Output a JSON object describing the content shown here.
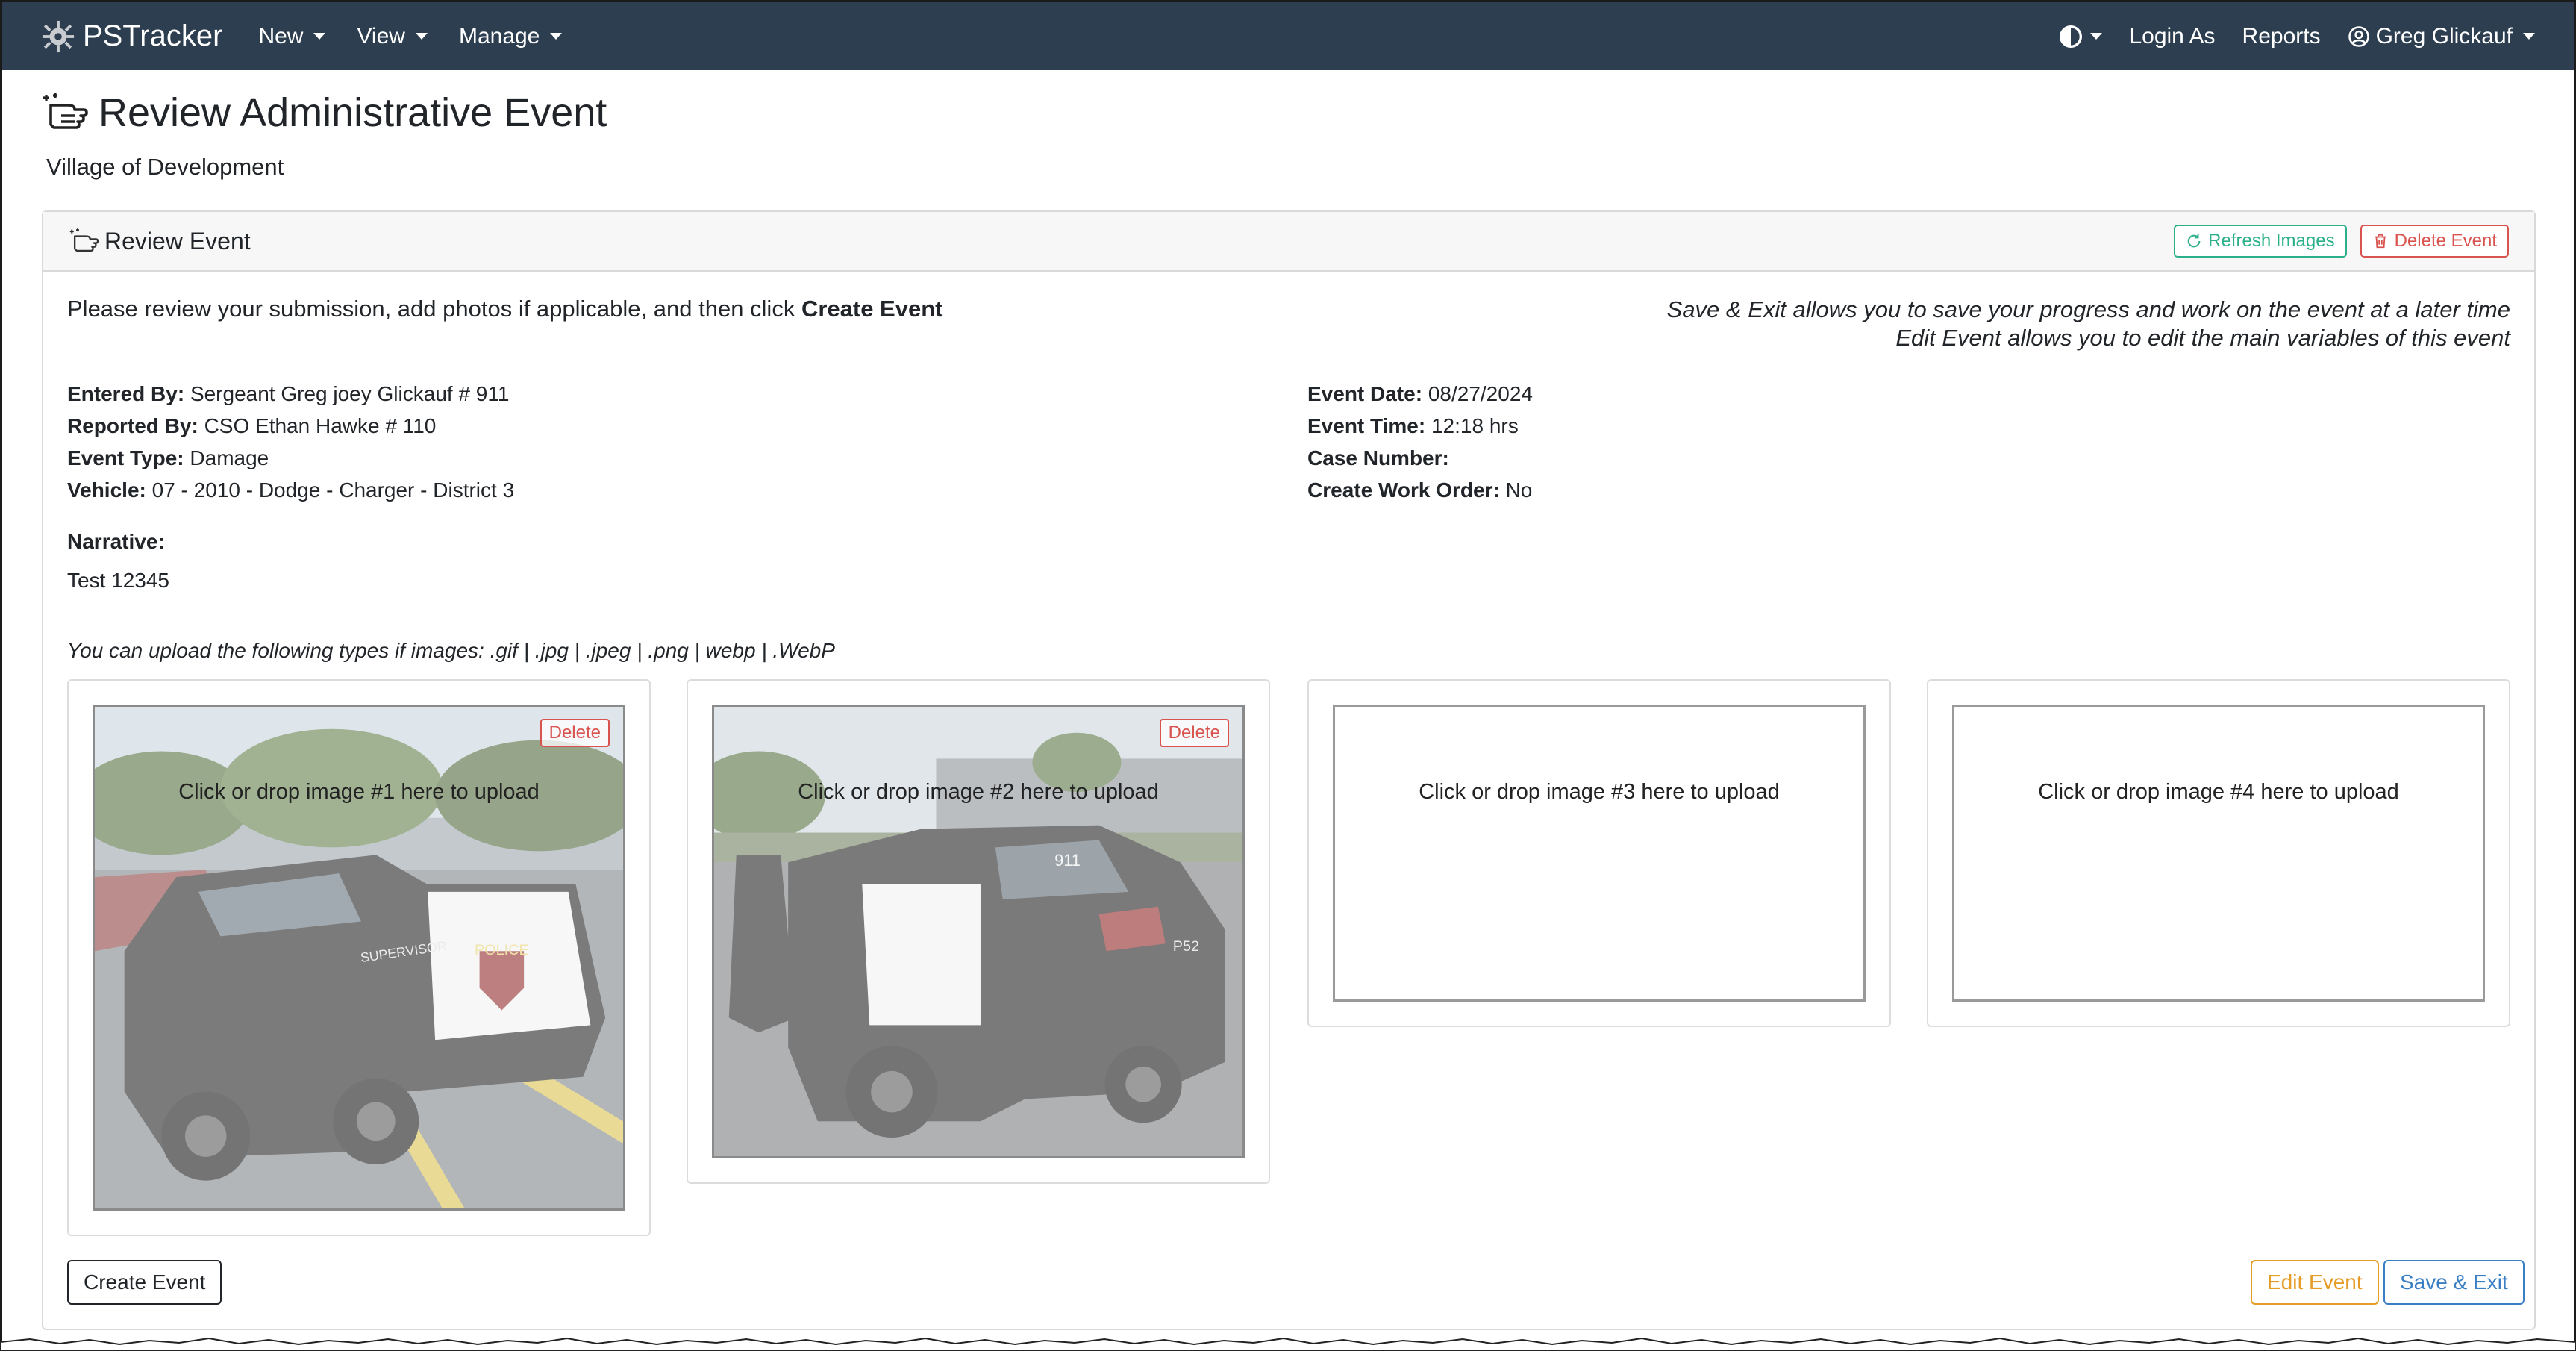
{
  "navbar": {
    "brand": "PSTracker",
    "menus": [
      "New",
      "View",
      "Manage"
    ],
    "login_as": "Login As",
    "reports": "Reports",
    "user": "Greg Glickauf"
  },
  "page": {
    "title": "Review Administrative Event",
    "subtitle": "Village of Development"
  },
  "card": {
    "header": "Review Event",
    "refresh_label": "Refresh Images",
    "delete_event_label": "Delete Event",
    "instruction_prefix": "Please review your submission, add photos if applicable, and then click ",
    "instruction_bold": "Create Event",
    "help_line1": "Save & Exit allows you to save your progress and work on the event at a later time",
    "help_line2": "Edit Event allows you to edit the main variables of this event"
  },
  "details_left": [
    {
      "label": "Entered By:",
      "value": "Sergeant Greg joey Glickauf # 911"
    },
    {
      "label": "Reported By:",
      "value": "CSO Ethan Hawke # 110"
    },
    {
      "label": "Event Type:",
      "value": "Damage"
    },
    {
      "label": "Vehicle:",
      "value": "07 - 2010 - Dodge - Charger - District 3"
    }
  ],
  "details_right": [
    {
      "label": "Event Date:",
      "value": "08/27/2024"
    },
    {
      "label": "Event Time:",
      "value": "12:18 hrs"
    },
    {
      "label": "Case Number:",
      "value": ""
    },
    {
      "label": "Create Work Order:",
      "value": "No"
    }
  ],
  "narrative": {
    "label": "Narrative:",
    "text": "Test 12345"
  },
  "upload_types": "You can upload the following types if images:   .gif | .jpg | .jpeg | .png | webp | .WebP",
  "uploads": [
    {
      "text": "Click or drop image #1 here to upload",
      "delete_label": "Delete",
      "photo_text": "POLICE",
      "photo_side": "SUPERVISOR"
    },
    {
      "text": "Click or drop image #2 here to upload",
      "delete_label": "Delete",
      "photo_text": "911",
      "photo_side": "P52"
    },
    {
      "text": "Click or drop image #3 here to upload"
    },
    {
      "text": "Click or drop image #4 here to upload"
    }
  ],
  "actions": {
    "create": "Create Event",
    "edit": "Edit Event",
    "save_exit": "Save & Exit"
  },
  "colors": {
    "navbar_bg": "#2c3e50",
    "green": "#2bb08a",
    "red": "#d9534f",
    "orange": "#e69d27",
    "blue": "#3a7fc3"
  }
}
